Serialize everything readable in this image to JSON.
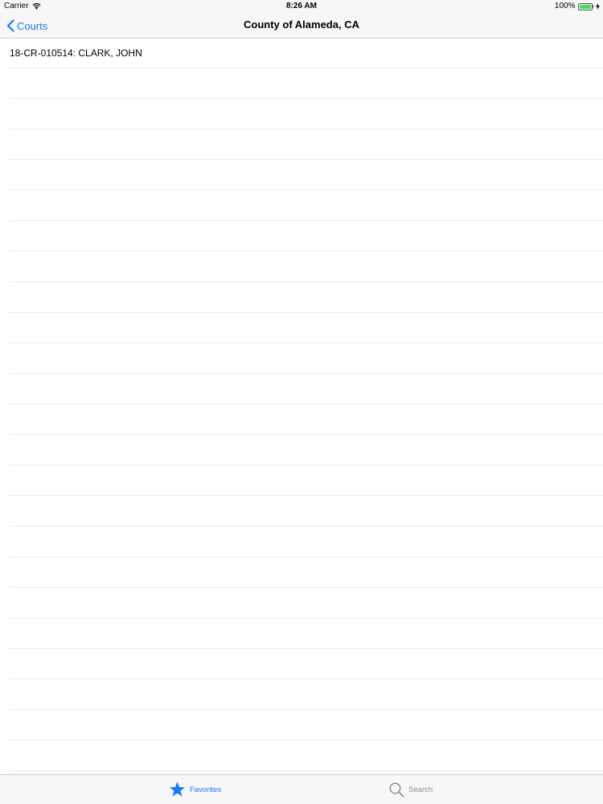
{
  "status_bar": {
    "carrier": "Carrier",
    "time": "8:26 AM",
    "battery": "100%"
  },
  "nav": {
    "back_label": "Courts",
    "title": "County of Alameda, CA"
  },
  "list": {
    "items": [
      {
        "label": "18-CR-010514: CLARK, JOHN"
      }
    ]
  },
  "tabs": [
    {
      "label": "Favorites",
      "icon": "star-icon",
      "selected": true
    },
    {
      "label": "Search",
      "icon": "search-icon",
      "selected": false
    }
  ],
  "colors": {
    "accent": "#1a7cf5",
    "inactive": "#8e8e93",
    "battery": "#4cd964"
  }
}
